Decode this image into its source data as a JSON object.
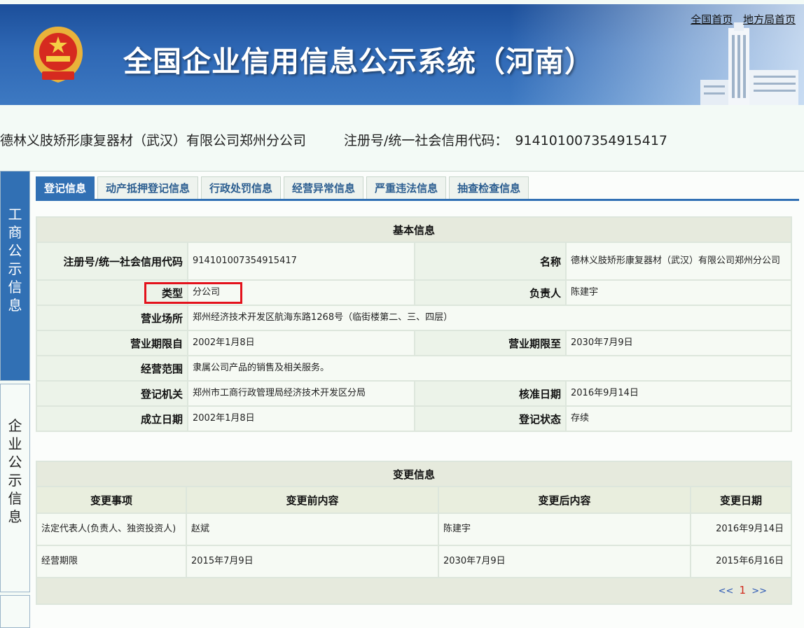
{
  "header": {
    "title": "全国企业信用信息公示系统（河南）",
    "links": [
      "全国首页",
      "地方局首页"
    ]
  },
  "company": {
    "name": "德林义肢矫形康复器材（武汉）有限公司郑州分公司",
    "reg_label": "注册号/统一社会信用代码：",
    "reg_value": "914101007354915417"
  },
  "side_tabs": [
    {
      "label": "工商公示信息",
      "active": true
    },
    {
      "label": "企业公示信息",
      "active": false
    }
  ],
  "tabs": [
    "登记信息",
    "动产抵押登记信息",
    "行政处罚信息",
    "经营异常信息",
    "严重违法信息",
    "抽查检查信息"
  ],
  "basic": {
    "title": "基本信息",
    "reg_label": "注册号/统一社会信用代码",
    "reg_value": "914101007354915417",
    "name_label": "名称",
    "name_value": "德林义肢矫形康复器材（武汉）有限公司郑州分公司",
    "type_label": "类型",
    "type_value": "分公司",
    "leader_label": "负责人",
    "leader_value": "陈建宇",
    "address_label": "营业场所",
    "address_value": "郑州经济技术开发区航海东路1268号（临街楼第二、三、四层）",
    "from_label": "营业期限自",
    "from_value": "2002年1月8日",
    "to_label": "营业期限至",
    "to_value": "2030年7月9日",
    "scope_label": "经营范围",
    "scope_value": "隶属公司产品的销售及相关服务。",
    "authority_label": "登记机关",
    "authority_value": "郑州市工商行政管理局经济技术开发区分局",
    "approve_label": "核准日期",
    "approve_value": "2016年9月14日",
    "found_label": "成立日期",
    "found_value": "2002年1月8日",
    "status_label": "登记状态",
    "status_value": "存续"
  },
  "changes": {
    "title": "变更信息",
    "columns": [
      "变更事项",
      "变更前内容",
      "变更后内容",
      "变更日期"
    ],
    "rows": [
      [
        "法定代表人(负责人、独资投资人)",
        "赵斌",
        "陈建宇",
        "2016年9月14日"
      ],
      [
        "经营期限",
        "2015年7月9日",
        "2030年7月9日",
        "2015年6月16日"
      ]
    ],
    "pagination": {
      "prev": "<<",
      "page": "1",
      "next": ">>"
    }
  },
  "colors": {
    "accent": "#3170b4",
    "highlight": "#e3121c"
  }
}
